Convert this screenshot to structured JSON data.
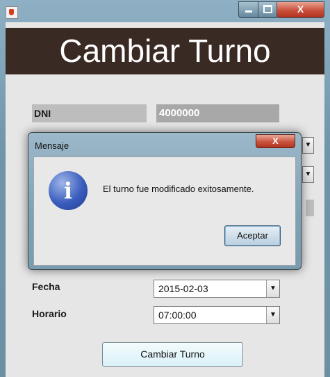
{
  "window": {
    "close_glyph": "X",
    "header_title": "Cambiar Turno"
  },
  "form": {
    "dni_label": "DNI",
    "dni_value": "4000000",
    "fecha_label": "Fecha",
    "fecha_value": "2015-02-03",
    "horario_label": "Horario",
    "horario_value": "07:00:00",
    "submit_label": "Cambiar Turno"
  },
  "dialog": {
    "title": "Mensaje",
    "close_glyph": "X",
    "message": "El turno fue modificado exitosamente.",
    "ok_label": "Aceptar",
    "icon": "info-icon"
  },
  "colors": {
    "header_bg": "#3a2a24",
    "window_chrome": "#7fa1b6",
    "close_red": "#c9503b"
  }
}
